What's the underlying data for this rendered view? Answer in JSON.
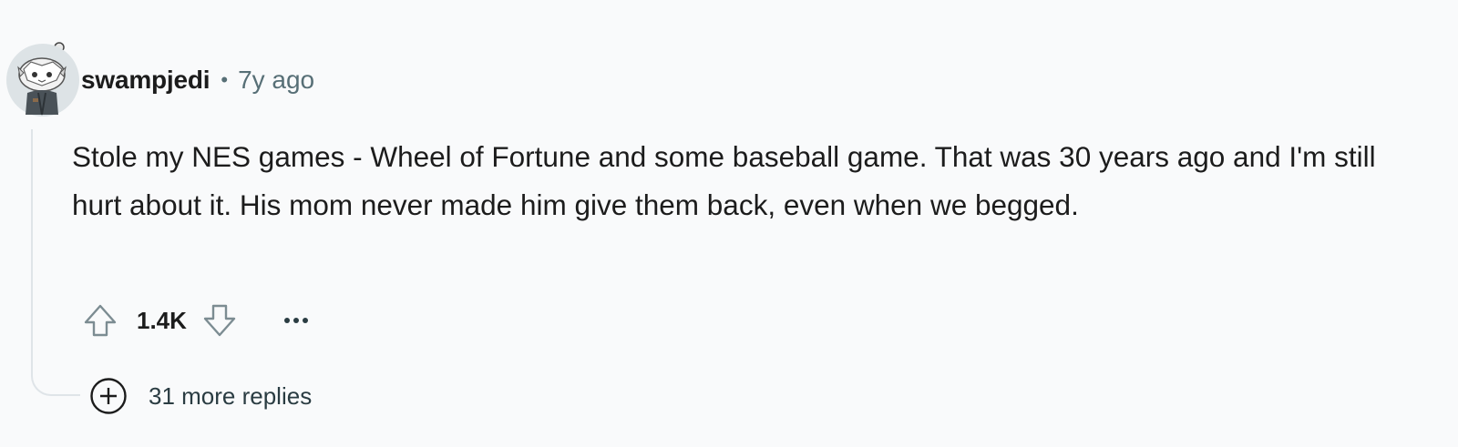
{
  "comment": {
    "author": "swampjedi",
    "separator": "•",
    "timestamp": "7y ago",
    "body": "Stole my NES games - Wheel of Fortune and some baseball game. That was 30 years ago and I'm still hurt about it. His mom never made him give them back, even when we begged.",
    "score": "1.4K",
    "more_replies": "31 more replies"
  },
  "icons": {
    "avatar": "snoo-avatar",
    "upvote": "upvote-arrow-icon",
    "downvote": "downvote-arrow-icon",
    "overflow": "ellipsis-icon",
    "expand": "plus-circle-icon"
  },
  "colors": {
    "background": "#f9fafb",
    "text": "#1c1c1c",
    "muted": "#576f76",
    "thread_line": "#dfe4e8"
  }
}
